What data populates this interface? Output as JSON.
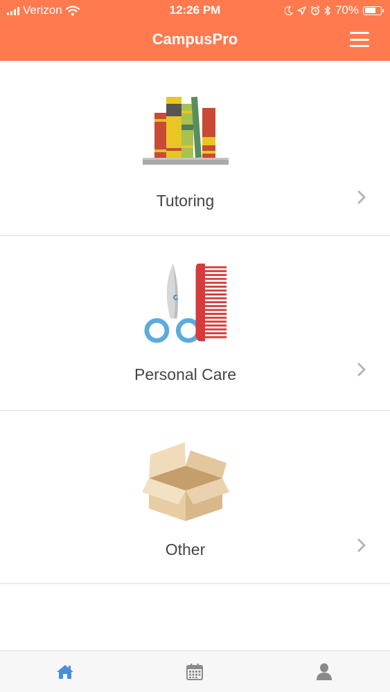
{
  "status_bar": {
    "carrier": "Verizon",
    "time": "12:26 PM",
    "battery_percent": "70%",
    "battery_level": 0.7
  },
  "nav": {
    "title": "CampusPro",
    "menu_icon": "hamburger-menu-icon"
  },
  "categories": [
    {
      "label": "Tutoring",
      "icon": "books-icon"
    },
    {
      "label": "Personal Care",
      "icon": "scissors-comb-icon"
    },
    {
      "label": "Other",
      "icon": "box-icon"
    }
  ],
  "tab_bar": {
    "tabs": [
      {
        "icon": "home-icon",
        "active": true
      },
      {
        "icon": "calendar-icon",
        "active": false
      },
      {
        "icon": "profile-icon",
        "active": false
      }
    ]
  },
  "colors": {
    "header": "#ff7a4f",
    "active_tab": "#4a8fd6",
    "inactive_tab": "#8a8a8a",
    "label": "#444444"
  }
}
